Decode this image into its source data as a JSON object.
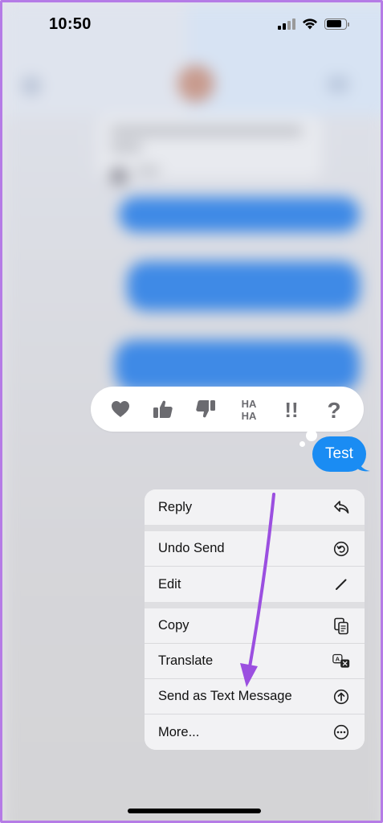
{
  "status_bar": {
    "time": "10:50",
    "icons": [
      "cellular-signal-icon",
      "wifi-icon",
      "battery-icon"
    ]
  },
  "reactions": [
    {
      "name": "heart",
      "icon": "heart-icon"
    },
    {
      "name": "thumbs-up",
      "icon": "thumbs-up-icon"
    },
    {
      "name": "thumbs-down",
      "icon": "thumbs-down-icon"
    },
    {
      "name": "haha",
      "icon": "haha-icon",
      "text_top": "HA",
      "text_bottom": "HA"
    },
    {
      "name": "emphasize",
      "icon": "double-exclamation-icon",
      "text": "!!"
    },
    {
      "name": "question",
      "icon": "question-mark-icon",
      "text": "?"
    }
  ],
  "message": {
    "text": "Test",
    "bubble_color": "#1a8cf3"
  },
  "context_menu": {
    "reply": {
      "label": "Reply",
      "icon": "reply-icon"
    },
    "undo_send": {
      "label": "Undo Send",
      "icon": "undo-icon"
    },
    "edit": {
      "label": "Edit",
      "icon": "pencil-icon"
    },
    "copy": {
      "label": "Copy",
      "icon": "copy-icon"
    },
    "translate": {
      "label": "Translate",
      "icon": "translate-icon"
    },
    "send_as_text": {
      "label": "Send as Text Message",
      "icon": "arrow-up-circle-icon"
    },
    "more": {
      "label": "More...",
      "icon": "ellipsis-circle-icon"
    }
  },
  "colors": {
    "accent_blue": "#1a8cf3",
    "annotation_arrow": "#9b4fe0",
    "frame_border": "#b57be6"
  }
}
